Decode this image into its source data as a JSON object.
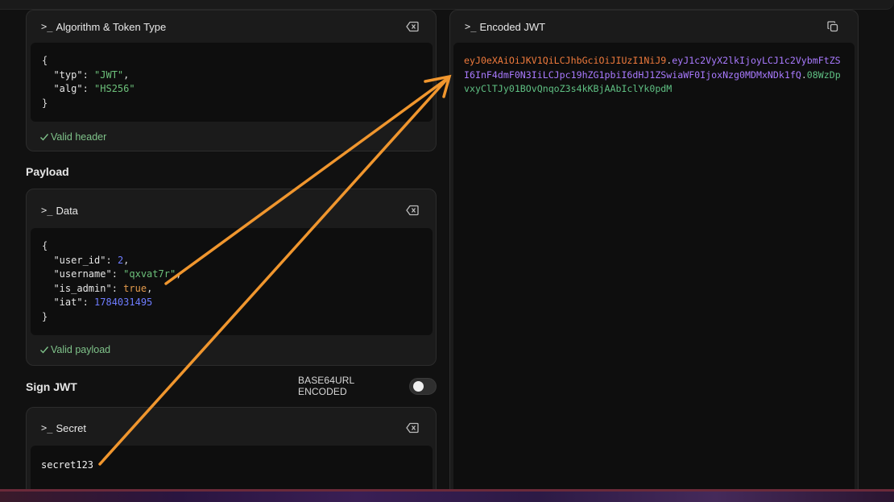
{
  "header_card": {
    "title": "Algorithm & Token Type",
    "prompt_glyph": ">_",
    "json_lines": [
      {
        "key": "\"typ\"",
        "value": "\"JWT\""
      },
      {
        "key": "\"alg\"",
        "value": "\"HS256\""
      }
    ],
    "status": "Valid header"
  },
  "payload_section": {
    "title": "Payload",
    "card_title": "Data",
    "prompt_glyph": ">_",
    "json_lines": [
      {
        "key": "\"user_id\"",
        "value": "2",
        "type": "number"
      },
      {
        "key": "\"username\"",
        "value": "\"qxvat7r\"",
        "type": "string"
      },
      {
        "key": "\"is_admin\"",
        "value": "true",
        "type": "bool"
      },
      {
        "key": "\"iat\"",
        "value": "1784031495",
        "type": "number"
      }
    ],
    "status": "Valid payload"
  },
  "sign_section": {
    "title": "Sign JWT",
    "toggle_label": "BASE64URL ENCODED",
    "toggle_on": false,
    "card_title": "Secret",
    "prompt_glyph": ">_",
    "secret_value": "secret123"
  },
  "encoded_card": {
    "title": "Encoded JWT",
    "prompt_glyph": ">_",
    "header_part": "eyJ0eXAiOiJKV1QiLCJhbGciOiJIUzI1NiJ9",
    "payload_part": "eyJ1c2VyX2lkIjoyLCJ1c2VybmFtZSI6InF4dmF0N3IiLCJpc19hZG1pbiI6dHJ1ZSwiaWF0IjoxNzg0MDMxNDk1fQ",
    "signature_part": "08WzDpvxyClTJy01BOvQnqoZ3s4kKBjAAbIclYk0pdM",
    "separator": "."
  },
  "colors": {
    "jwt_header": "#ef7a3c",
    "jwt_payload": "#a97aff",
    "jwt_signature": "#5fc083",
    "annotation_arrow": "#f0962e",
    "valid_status": "#7fc38a"
  },
  "icons": {
    "clear": "clear-input-icon",
    "copy": "copy-icon",
    "check": "check-icon"
  }
}
